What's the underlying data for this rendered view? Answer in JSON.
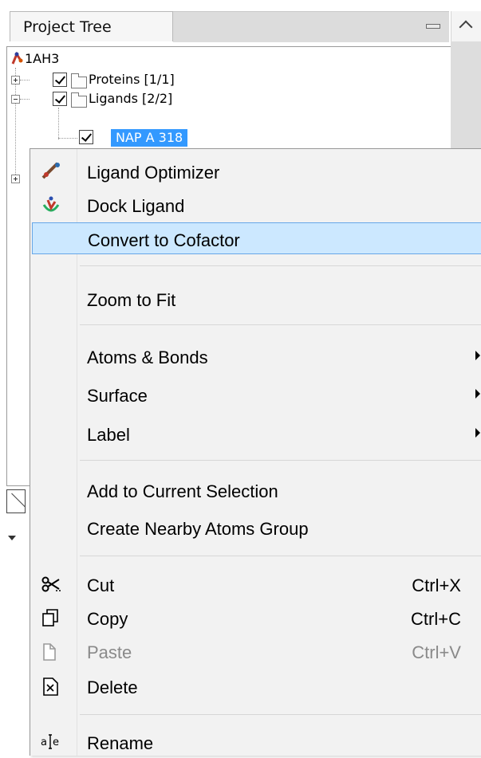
{
  "panel": {
    "title": "Project Tree"
  },
  "tree": {
    "root_label": "1AH3",
    "proteins_label": "Proteins [1/1]",
    "ligands_label": "Ligands [2/2]",
    "selected_label": "NAP A 318"
  },
  "context_menu": {
    "items": [
      {
        "label": "Ligand Optimizer",
        "icon": "ligand-optimizer-icon"
      },
      {
        "label": "Dock Ligand",
        "icon": "dock-ligand-icon"
      },
      {
        "label": "Convert to Cofactor"
      },
      {
        "label": "Zoom to Fit"
      },
      {
        "label": "Atoms & Bonds",
        "submenu": true
      },
      {
        "label": "Surface",
        "submenu": true
      },
      {
        "label": "Label",
        "submenu": true
      },
      {
        "label": "Add to Current Selection"
      },
      {
        "label": "Create Nearby Atoms Group"
      },
      {
        "label": "Cut",
        "shortcut": "Ctrl+X",
        "icon": "scissors-icon"
      },
      {
        "label": "Copy",
        "shortcut": "Ctrl+C",
        "icon": "copy-icon"
      },
      {
        "label": "Paste",
        "shortcut": "Ctrl+V",
        "icon": "paste-icon",
        "disabled": true
      },
      {
        "label": "Delete",
        "icon": "delete-icon"
      },
      {
        "label": "Rename",
        "icon": "rename-icon"
      }
    ]
  },
  "colors": {
    "selection": "#3399ff",
    "menu_highlight": "#cce8ff",
    "menu_highlight_border": "#66a7e8"
  }
}
